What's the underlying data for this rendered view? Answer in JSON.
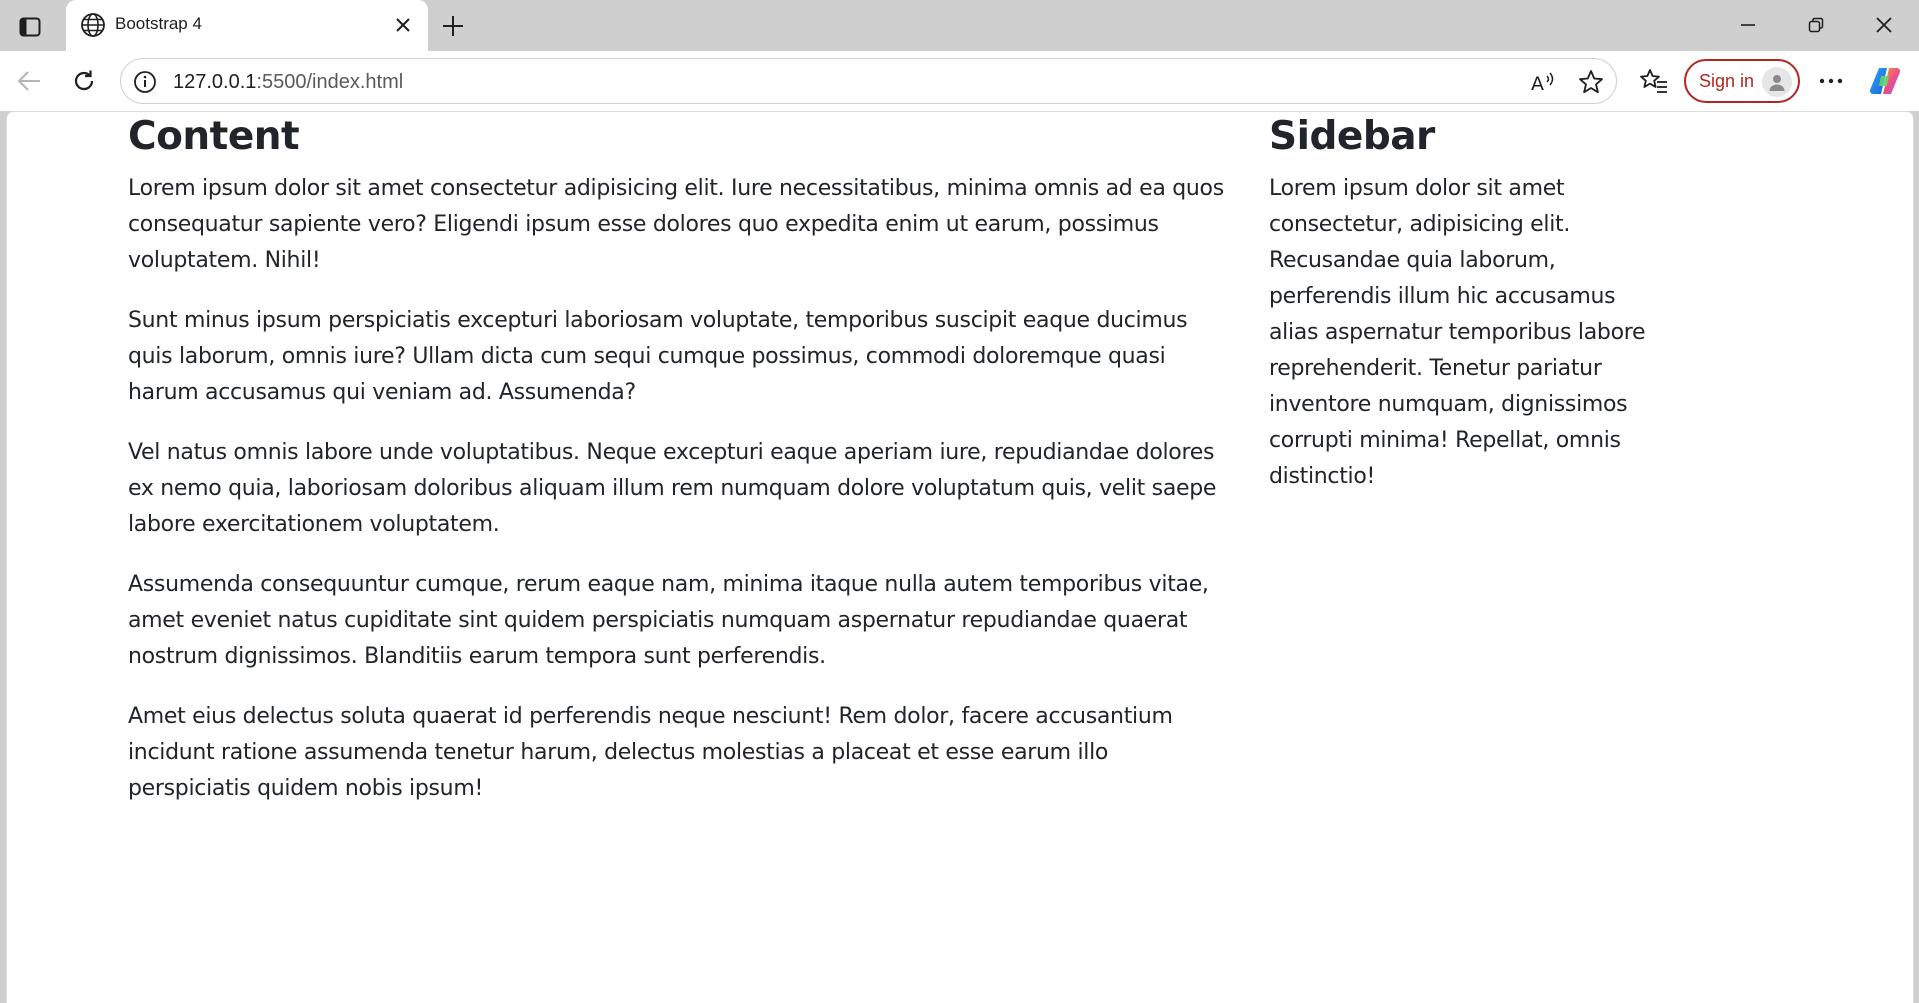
{
  "browser": {
    "tab": {
      "title": "Bootstrap 4"
    },
    "address": {
      "host": "127.0.0.1",
      "path": ":5500/index.html"
    },
    "signin_label": "Sign in",
    "accent_color": "#b3261e"
  },
  "page": {
    "content": {
      "heading": "Content",
      "paragraphs": [
        "Lorem ipsum dolor sit amet consectetur adipisicing elit. Iure necessitatibus, minima omnis ad ea quos consequatur sapiente vero? Eligendi ipsum esse dolores quo expedita enim ut earum, possimus voluptatem. Nihil!",
        "Sunt minus ipsum perspiciatis excepturi laboriosam voluptate, temporibus suscipit eaque ducimus quis laborum, omnis iure? Ullam dicta cum sequi cumque possimus, commodi doloremque quasi harum accusamus qui veniam ad. Assumenda?",
        "Vel natus omnis labore unde voluptatibus. Neque excepturi eaque aperiam iure, repudiandae dolores ex nemo quia, laboriosam doloribus aliquam illum rem numquam dolore voluptatum quis, velit saepe labore exercitationem voluptatem.",
        "Assumenda consequuntur cumque, rerum eaque nam, minima itaque nulla autem temporibus vitae, amet eveniet natus cupiditate sint quidem perspiciatis numquam aspernatur repudiandae quaerat nostrum dignissimos. Blanditiis earum tempora sunt perferendis.",
        "Amet eius delectus soluta quaerat id perferendis neque nesciunt! Rem dolor, facere accusantium incidunt ratione assumenda tenetur harum, delectus molestias a placeat et esse earum illo perspiciatis quidem nobis ipsum!"
      ]
    },
    "sidebar": {
      "heading": "Sidebar",
      "text": "Lorem ipsum dolor sit amet consectetur, adipisicing elit. Recusandae quia laborum, perferendis illum hic accusamus alias aspernatur temporibus labore reprehenderit. Tenetur pariatur inventore numquam, dignissimos corrupti minima! Repellat, omnis distinctio!"
    }
  }
}
